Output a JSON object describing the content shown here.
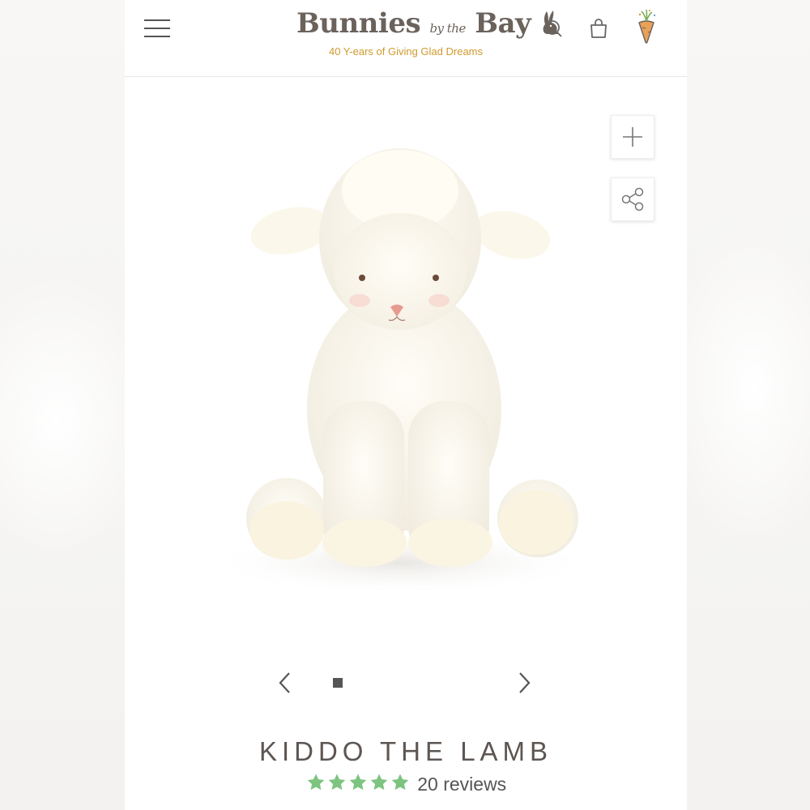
{
  "header": {
    "menu_icon": "hamburger-menu-icon",
    "logo": {
      "brand_word1": "Bunnies",
      "brand_small": "by the",
      "brand_word2": "Bay",
      "tagline": "40 Y-ears of Giving Glad Dreams"
    },
    "icons": [
      "search-icon",
      "bag-icon",
      "carrot-icon"
    ]
  },
  "gallery": {
    "image_subject": "kiddo-the-lamb-plush",
    "zoom_icon": "plus-icon",
    "share_icon": "share-icon",
    "prev_icon": "chevron-left-icon",
    "next_icon": "chevron-right-icon",
    "active_dot": 1
  },
  "product": {
    "title": "KIDDO THE LAMB",
    "rating": 5,
    "review_count_text": "20 reviews"
  },
  "colors": {
    "star": "#7cc47f",
    "text": "#5d5652",
    "tagline": "#d09a2e"
  }
}
